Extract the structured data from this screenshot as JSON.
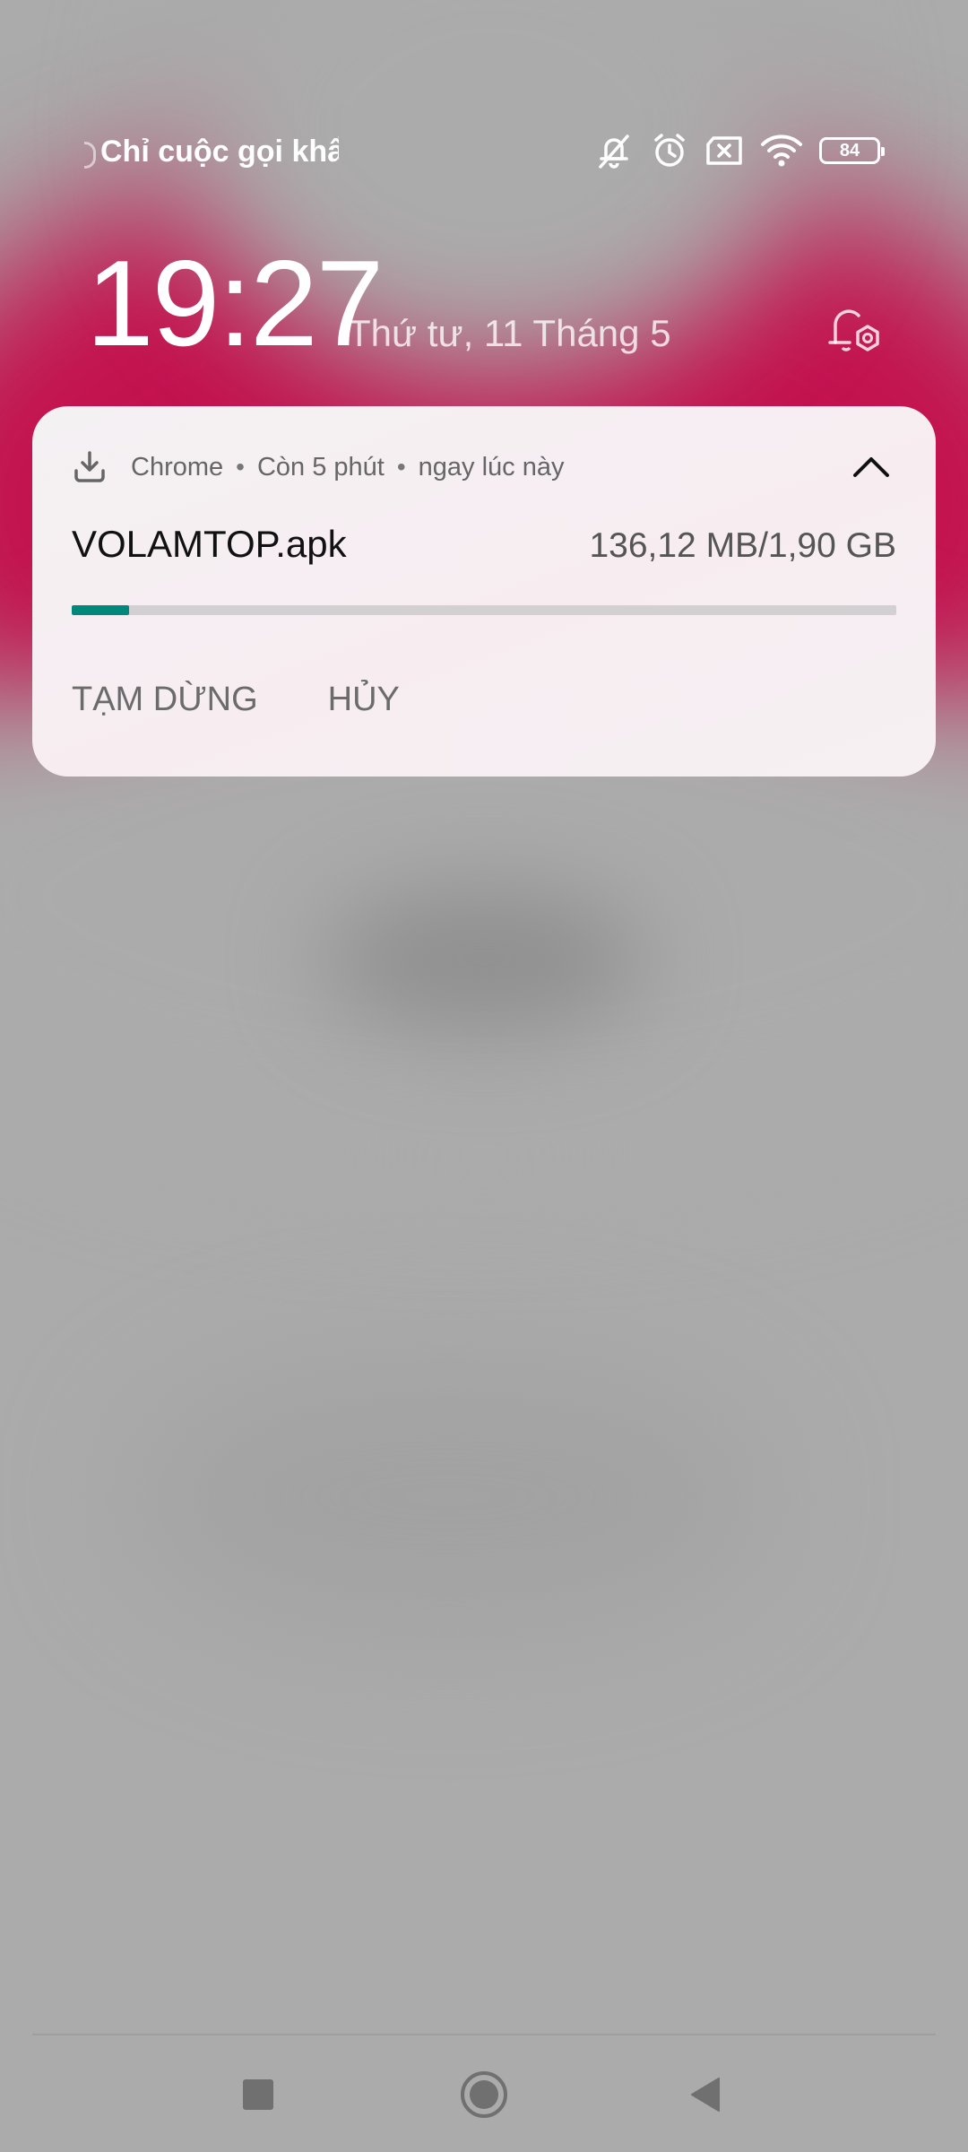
{
  "status_bar": {
    "carrier_text": "Chỉ cuộc gọi khẩn cấp",
    "icons": [
      "silent-bell-icon",
      "alarm-icon",
      "no-sim-icon",
      "wifi-icon",
      "battery-icon"
    ],
    "battery_level": "84"
  },
  "lockscreen": {
    "time": "19:27",
    "date": "Thứ tư, 11 Tháng 5"
  },
  "notification": {
    "app_name": "Chrome",
    "time_remaining": "Còn 5 phút",
    "time_posted": "ngay lúc này",
    "file_name": "VOLAMTOP.apk",
    "size_progress": "136,12 MB/1,90 GB",
    "progress_fraction": 0.07,
    "actions": {
      "pause": "TẠM DỪNG",
      "cancel": "HỦY"
    }
  },
  "nav_bar": {
    "buttons": [
      "recents-square-icon",
      "home-circle-icon",
      "back-triangle-icon"
    ]
  },
  "colors": {
    "accent_progress": "#00897b",
    "wallpaper_magenta": "#c3124e",
    "background_gray": "#ababab"
  }
}
